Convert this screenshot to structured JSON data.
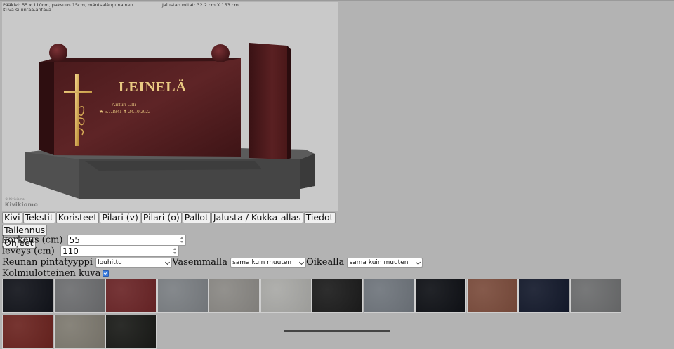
{
  "preview": {
    "info_left_line1": "Pääkivi: 55 x 110cm, paksuus 15cm, mäntsalänpunainen",
    "info_left_line2": "Kuva suuntaa-antava",
    "info_right": "Jalustan mitat: 32.2 cm X 153 cm",
    "engraving_name": "LEINELÄ",
    "engraving_first_names": "Arrturi Olli",
    "engraving_dates": "★ 5.7.1941 ✝ 24.10.2022",
    "logo_small": "© Kivikiomo",
    "logo_big": "Kivikiomo"
  },
  "tabs": [
    "Kivi",
    "Tekstit",
    "Koristeet",
    "Pilari (v)",
    "Pilari (o)",
    "Pallot",
    "Jalusta / Kukka-allas",
    "Tiedot",
    "Tallennus",
    "Ohjeet"
  ],
  "form": {
    "height_label": "korkeus (cm)",
    "height_value": "55",
    "width_label": "leveys (cm)",
    "width_value": "110",
    "edge_label": "Reunan pintatyyppi",
    "edge_value": "louhittu",
    "left_label": "Vasemmalla",
    "left_value": "sama kuin muuten",
    "right_label": "Oikealla",
    "right_value": "sama kuin muuten",
    "threed_label": "Kolmiulotteinen kuva",
    "threed_checked": true
  },
  "swatch_colors": [
    "#12141b",
    "#6d6e70",
    "#6b2527",
    "#7b7f83",
    "#8a8884",
    "#a9a9a6",
    "#1c1c1c",
    "#6f757c",
    "#0f1116",
    "#7b4c3c",
    "#141a2c",
    "#6c6d6e",
    "#6b2420",
    "#7e7a70",
    "#1a1b18"
  ]
}
